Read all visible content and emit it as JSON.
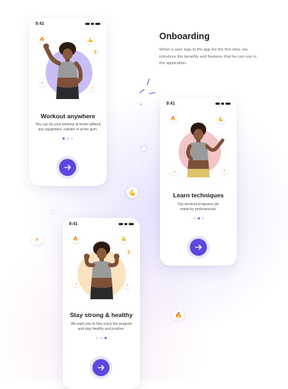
{
  "heading": "Onboarding",
  "intro_text": "When a user logs in the app for the first time, we introduce the benefits and features that he can use in the application.",
  "colors": {
    "accent": "#5b48df",
    "blob_purple": "#c9bdf5",
    "blob_pink": "#f4c5c7",
    "blob_peach": "#fbe3bf"
  },
  "screens": [
    {
      "time": "9:41",
      "title": "Workout anywhere",
      "description": "You can do your workout at home without any equipment, outside or at the gym.",
      "page_indicator": {
        "current": 1,
        "total": 3
      },
      "next_icon": "arrow-right-icon"
    },
    {
      "time": "9:41",
      "title": "Learn techniques",
      "description": "Our workout programs are made by professionals.",
      "page_indicator": {
        "current": 2,
        "total": 3
      },
      "next_icon": "arrow-right-icon"
    },
    {
      "time": "9:41",
      "title": "Stay strong & healthy",
      "description": "We want you to fully enjoy the program and stay healthy and positive.",
      "page_indicator": {
        "current": 3,
        "total": 3
      },
      "next_icon": "arrow-right-icon"
    }
  ],
  "floating_badges": [
    {
      "icon": "muscle-arm-icon",
      "glyph": "💪"
    },
    {
      "icon": "dumbbell-icon",
      "glyph": "✕"
    },
    {
      "icon": "fire-icon",
      "glyph": "🔥"
    }
  ],
  "badge_glyphs": {
    "fire": "🔥",
    "muscle": "💪",
    "trophy": "🏆",
    "star": "✦"
  }
}
